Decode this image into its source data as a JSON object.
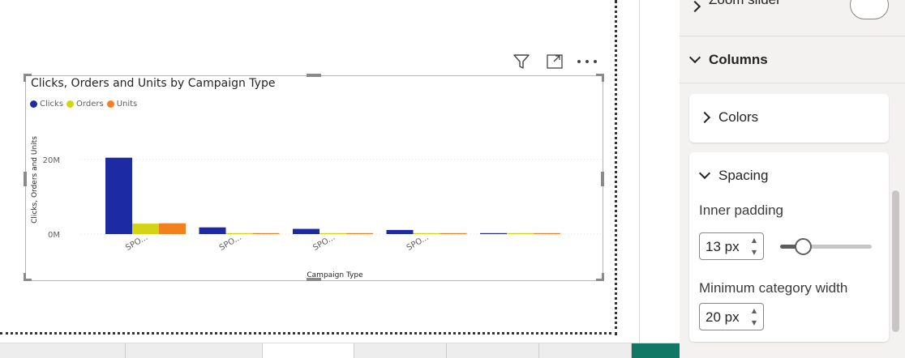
{
  "visual": {
    "title": "Clicks, Orders and Units by Campaign Type",
    "header_icons": [
      "filter-icon",
      "focus-mode-icon",
      "more-options-icon"
    ]
  },
  "chart_data": {
    "type": "bar",
    "title": "Clicks, Orders and Units by Campaign Type",
    "xlabel": "Campaign Type",
    "ylabel": "Clicks, Orders and Units",
    "categories": [
      "SPO...",
      "SPO...",
      "SPO...",
      "SPO...",
      ""
    ],
    "series": [
      {
        "name": "Clicks",
        "color": "#1c2aa3",
        "values": [
          20.5,
          1.8,
          1.4,
          1.1,
          0.15
        ]
      },
      {
        "name": "Orders",
        "color": "#d3d413",
        "values": [
          2.8,
          0.12,
          0.1,
          0.08,
          0.02
        ]
      },
      {
        "name": "Units",
        "color": "#f2801f",
        "values": [
          2.9,
          0.13,
          0.11,
          0.09,
          0.02
        ]
      }
    ],
    "yticks": [
      {
        "value": 0,
        "label": "0M"
      },
      {
        "value": 20,
        "label": "20M"
      }
    ],
    "ylim": [
      0,
      20
    ],
    "grid": true,
    "legend": "top-left"
  },
  "pane": {
    "zoom_slider_label": "Zoom slider",
    "columns_label": "Columns",
    "colors_label": "Colors",
    "spacing_label": "Spacing",
    "inner_padding_label": "Inner padding",
    "inner_padding_value": "13 px",
    "inner_padding_slider_level": 0.25,
    "min_category_width_label": "Minimum category width",
    "min_category_width_value": "20 px"
  }
}
